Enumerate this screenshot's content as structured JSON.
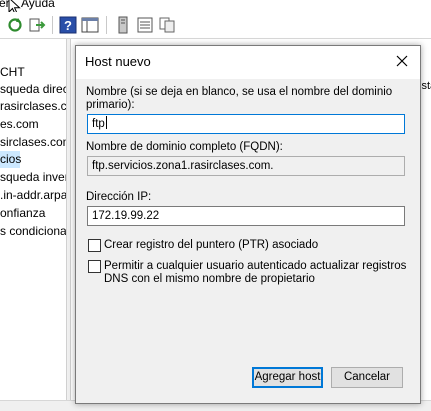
{
  "menu": {
    "items": [
      "er",
      "Ayuda"
    ]
  },
  "tree": {
    "items": [
      {
        "label": "CHT",
        "selected": false
      },
      {
        "label": "squeda direc",
        "selected": false
      },
      {
        "label": "rasirclases.com",
        "selected": false
      },
      {
        "label": "es.com",
        "selected": false
      },
      {
        "label": "sirclases.com",
        "selected": false
      },
      {
        "label": "cios",
        "selected": true
      },
      {
        "label": "squeda inver",
        "selected": false
      },
      {
        "label": ".in-addr.arpa",
        "selected": false
      },
      {
        "label": "onfianza",
        "selected": false
      },
      {
        "label": "s condiciona",
        "selected": false
      }
    ]
  },
  "right_pane": {
    "fragments": [
      "i",
      "ista"
    ]
  },
  "dialog": {
    "title": "Host nuevo",
    "name_label": "Nombre (si se deja en blanco, se usa el nombre del dominio primario):",
    "name_label_line1": "Nombre (si se deja en blanco, se usa el nombre del dominio",
    "name_label_line2": "primario):",
    "name_value": "ftp",
    "fqdn_label": "Nombre de dominio completo (FQDN):",
    "fqdn_value": "ftp.servicios.zona1.rasirclases.com.",
    "ip_label": "Dirección IP:",
    "ip_value": "172.19.99.22",
    "ptr_label": "Crear registro del puntero (PTR) asociado",
    "ptr_checked": false,
    "update_label_line1": "Permitir a cualquier usuario autenticado actualizar registros",
    "update_label_line2": "DNS con el mismo nombre de propietario",
    "update_checked": false,
    "add_button": "Agregar host",
    "cancel_button": "Cancelar"
  },
  "colors": {
    "selection": "#cce8ff",
    "focus_border": "#0078d7",
    "dialog_body": "#f0f0f0"
  }
}
